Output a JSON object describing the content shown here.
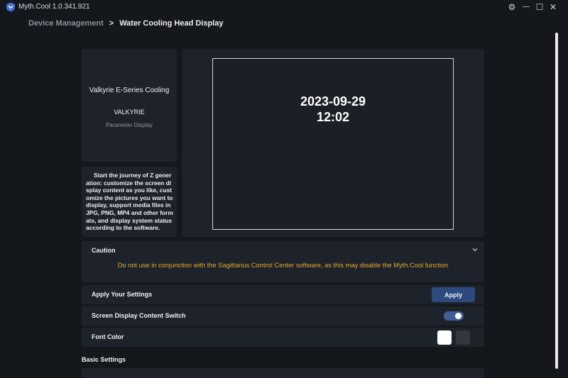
{
  "app": {
    "title": "Myth.Cool 1.0.341.921",
    "accent": "#2c4a7e",
    "warning_color": "#e3a62a"
  },
  "window_controls": [
    {
      "name": "settings",
      "glyph": "⚙"
    },
    {
      "name": "minimize",
      "glyph": "—"
    },
    {
      "name": "maximize",
      "glyph": "☐"
    },
    {
      "name": "close",
      "glyph": "✕"
    }
  ],
  "breadcrumb": {
    "parent": "Device Management",
    "separator": ">",
    "current": "Water Cooling Head Display"
  },
  "device": {
    "name": "Valkyrie E-Series Cooling",
    "model": "VALKYRIE",
    "subtitle": "Parameter Display",
    "description": "Start the journey of Z generation: customize the screen display content as you like, customize the pictures you want to display, support media files in JPG, PNG, MP4 and other formats, and display system status according to the software."
  },
  "preview": {
    "date": "2023-09-29",
    "time": "12:02"
  },
  "caution": {
    "title": "Caution",
    "message": "Do not use in conjunction with the Sagittarius Control Center software, as this may disable the Myth.Cool function"
  },
  "settings": {
    "apply_label": "Apply Your Settings",
    "apply_button": "Apply",
    "screen_switch_label": "Screen Display Content Switch",
    "screen_switch_on": true,
    "font_color_label": "Font Color",
    "font_colors": [
      "#ffffff",
      "#34373c"
    ],
    "selected_font_color": "#ffffff"
  },
  "sections": {
    "basic_settings": "Basic Settings"
  }
}
